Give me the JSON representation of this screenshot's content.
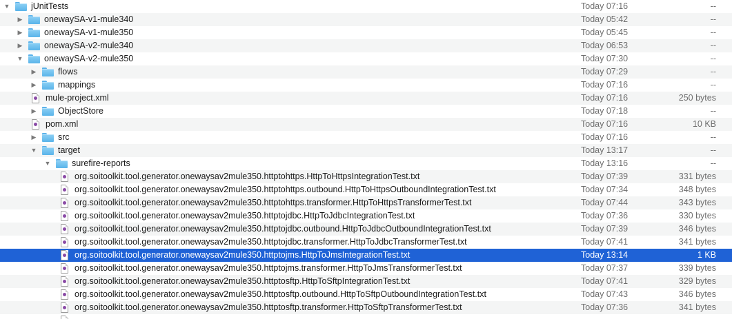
{
  "rows": [
    {
      "level": 0,
      "kind": "folder",
      "disclosure": "open",
      "name": "jUnitTests",
      "date": "Today 07:16",
      "size": "--"
    },
    {
      "level": 1,
      "kind": "folder",
      "disclosure": "closed",
      "name": "onewaySA-v1-mule340",
      "date": "Today 05:42",
      "size": "--"
    },
    {
      "level": 1,
      "kind": "folder",
      "disclosure": "closed",
      "name": "onewaySA-v1-mule350",
      "date": "Today 05:45",
      "size": "--"
    },
    {
      "level": 1,
      "kind": "folder",
      "disclosure": "closed",
      "name": "onewaySA-v2-mule340",
      "date": "Today 06:53",
      "size": "--"
    },
    {
      "level": 1,
      "kind": "folder",
      "disclosure": "open",
      "name": "onewaySA-v2-mule350",
      "date": "Today 07:30",
      "size": "--"
    },
    {
      "level": 2,
      "kind": "folder",
      "disclosure": "closed",
      "name": "flows",
      "date": "Today 07:29",
      "size": "--"
    },
    {
      "level": 2,
      "kind": "folder",
      "disclosure": "closed",
      "name": "mappings",
      "date": "Today 07:16",
      "size": "--"
    },
    {
      "level": 2,
      "kind": "file",
      "disclosure": "none",
      "name": "mule-project.xml",
      "date": "Today 07:16",
      "size": "250 bytes"
    },
    {
      "level": 2,
      "kind": "folder",
      "disclosure": "closed",
      "name": "ObjectStore",
      "date": "Today 07:18",
      "size": "--"
    },
    {
      "level": 2,
      "kind": "file",
      "disclosure": "none",
      "name": "pom.xml",
      "date": "Today 07:16",
      "size": "10 KB"
    },
    {
      "level": 2,
      "kind": "folder",
      "disclosure": "closed",
      "name": "src",
      "date": "Today 07:16",
      "size": "--"
    },
    {
      "level": 2,
      "kind": "folder",
      "disclosure": "open",
      "name": "target",
      "date": "Today 13:17",
      "size": "--"
    },
    {
      "level": 3,
      "kind": "folder",
      "disclosure": "open",
      "name": "surefire-reports",
      "date": "Today 13:16",
      "size": "--"
    },
    {
      "level": 4,
      "kind": "file",
      "disclosure": "none",
      "name": "org.soitoolkit.tool.generator.onewaysav2mule350.httptohttps.HttpToHttpsIntegrationTest.txt",
      "date": "Today 07:39",
      "size": "331 bytes"
    },
    {
      "level": 4,
      "kind": "file",
      "disclosure": "none",
      "name": "org.soitoolkit.tool.generator.onewaysav2mule350.httptohttps.outbound.HttpToHttpsOutboundIntegrationTest.txt",
      "date": "Today 07:34",
      "size": "348 bytes"
    },
    {
      "level": 4,
      "kind": "file",
      "disclosure": "none",
      "name": "org.soitoolkit.tool.generator.onewaysav2mule350.httptohttps.transformer.HttpToHttpsTransformerTest.txt",
      "date": "Today 07:44",
      "size": "343 bytes"
    },
    {
      "level": 4,
      "kind": "file",
      "disclosure": "none",
      "name": "org.soitoolkit.tool.generator.onewaysav2mule350.httptojdbc.HttpToJdbcIntegrationTest.txt",
      "date": "Today 07:36",
      "size": "330 bytes"
    },
    {
      "level": 4,
      "kind": "file",
      "disclosure": "none",
      "name": "org.soitoolkit.tool.generator.onewaysav2mule350.httptojdbc.outbound.HttpToJdbcOutboundIntegrationTest.txt",
      "date": "Today 07:39",
      "size": "346 bytes"
    },
    {
      "level": 4,
      "kind": "file",
      "disclosure": "none",
      "name": "org.soitoolkit.tool.generator.onewaysav2mule350.httptojdbc.transformer.HttpToJdbcTransformerTest.txt",
      "date": "Today 07:41",
      "size": "341 bytes"
    },
    {
      "level": 4,
      "kind": "file",
      "disclosure": "none",
      "name": "org.soitoolkit.tool.generator.onewaysav2mule350.httptojms.HttpToJmsIntegrationTest.txt",
      "date": "Today 13:14",
      "size": "1 KB",
      "selected": true
    },
    {
      "level": 4,
      "kind": "file",
      "disclosure": "none",
      "name": "org.soitoolkit.tool.generator.onewaysav2mule350.httptojms.transformer.HttpToJmsTransformerTest.txt",
      "date": "Today 07:37",
      "size": "339 bytes"
    },
    {
      "level": 4,
      "kind": "file",
      "disclosure": "none",
      "name": "org.soitoolkit.tool.generator.onewaysav2mule350.httptosftp.HttpToSftpIntegrationTest.txt",
      "date": "Today 07:41",
      "size": "329 bytes"
    },
    {
      "level": 4,
      "kind": "file",
      "disclosure": "none",
      "name": "org.soitoolkit.tool.generator.onewaysav2mule350.httptosftp.outbound.HttpToSftpOutboundIntegrationTest.txt",
      "date": "Today 07:43",
      "size": "346 bytes"
    },
    {
      "level": 4,
      "kind": "file",
      "disclosure": "none",
      "name": "org.soitoolkit.tool.generator.onewaysav2mule350.httptosftp.transformer.HttpToSftpTransformerTest.txt",
      "date": "Today 07:36",
      "size": "341 bytes"
    },
    {
      "level": 4,
      "kind": "file",
      "disclosure": "none",
      "name": "",
      "date": "",
      "size": ""
    }
  ],
  "icons": {
    "folder": "folder-icon",
    "file": "document-icon",
    "open": "disclosure-open-icon",
    "closed": "disclosure-closed-icon"
  },
  "colors": {
    "selection": "#1f62d6",
    "alt_row": "#f4f5f5",
    "folder": "#5ab4ea"
  }
}
